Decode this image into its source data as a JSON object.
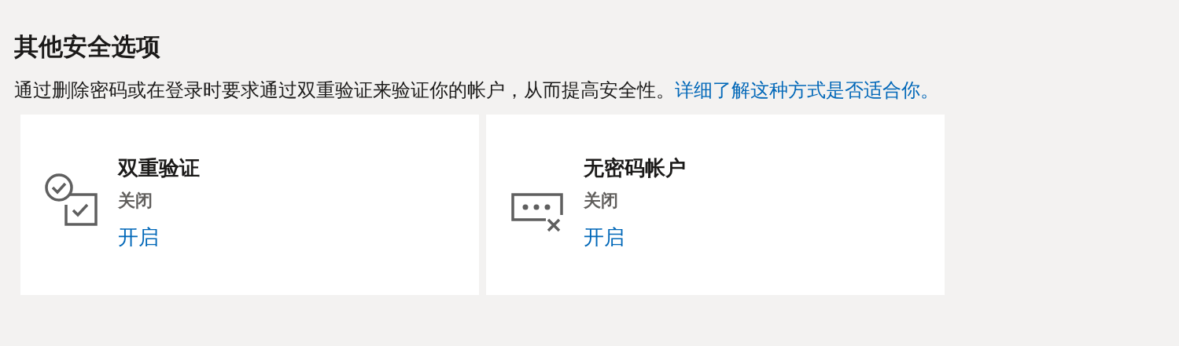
{
  "heading": "其他安全选项",
  "description": {
    "text": "通过删除密码或在登录时要求通过双重验证来验证你的帐户，从而提高安全性。",
    "link": "详细了解这种方式是否适合你。"
  },
  "cards": [
    {
      "kind": "two-step",
      "title": "双重验证",
      "status": "关闭",
      "action": "开启"
    },
    {
      "kind": "passwordless",
      "title": "无密码帐户",
      "status": "关闭",
      "action": "开启"
    }
  ]
}
